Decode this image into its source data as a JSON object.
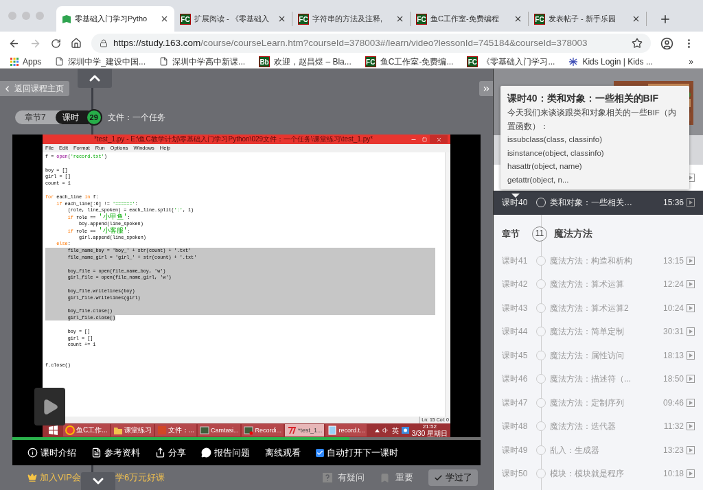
{
  "browser": {
    "tabs": [
      {
        "title": "零基础入门学习Pytho",
        "selected": true,
        "favicon": {
          "kind": "book"
        }
      },
      {
        "title": "扩展阅读 - 《零基础入",
        "selected": false,
        "favicon": {
          "kind": "letters",
          "text": "FC"
        }
      },
      {
        "title": "字符串的方法及注释,",
        "selected": false,
        "favicon": {
          "kind": "letters",
          "text": "FC"
        }
      },
      {
        "title": "鱼C工作室-免费编程",
        "selected": false,
        "favicon": {
          "kind": "letters",
          "text": "FC"
        }
      },
      {
        "title": "发表帖子 - 新手乐园",
        "selected": false,
        "favicon": {
          "kind": "letters",
          "text": "FC"
        }
      }
    ],
    "url": {
      "scheme": "https://",
      "host": "study.163.com",
      "path": "/course/courseLearn.htm?courseId=378003#/learn/video?lessonId=745184&courseId=378003"
    },
    "bookmarks": [
      {
        "label": "Apps",
        "icon": {
          "kind": "grid"
        }
      },
      {
        "label": "深圳中学_建设中国...",
        "icon": {
          "kind": "page"
        }
      },
      {
        "label": "深圳中学高中新课...",
        "icon": {
          "kind": "page"
        }
      },
      {
        "label": "欢迎，赵昌煜 – Bla...",
        "icon": {
          "kind": "letters",
          "text": "Bb"
        }
      },
      {
        "label": "鱼C工作室-免费编...",
        "icon": {
          "kind": "letters",
          "text": "FC"
        }
      },
      {
        "label": "《零基础入门学习...",
        "icon": {
          "kind": "letters",
          "text": "FC"
        }
      },
      {
        "label": "Kids Login | Kids ...",
        "icon": {
          "kind": "kids"
        }
      }
    ],
    "bookmarks_more": "»"
  },
  "player": {
    "back_button": "返回课程主页",
    "breadcrumb": {
      "chapter": "章节7",
      "lesson_label": "课时",
      "lesson_number": "29",
      "title": "文件：一个任务"
    },
    "recording": {
      "window_title": "*test_1.py - E:\\鱼C教学计划\\零基础入门学习Python\\029文件：一个任务\\课堂练习\\test_1.py*",
      "menu": [
        "File",
        "Edit",
        "Format",
        "Run",
        "Options",
        "Windows",
        "Help"
      ],
      "code_lines": [
        {
          "selected": false,
          "segments": [
            {
              "text": "f = ",
              "kind": "plain"
            },
            {
              "text": "open",
              "kind": "builtin"
            },
            {
              "text": "(",
              "kind": "plain"
            },
            {
              "text": "'record.txt'",
              "kind": "string"
            },
            {
              "text": ")",
              "kind": "plain"
            }
          ]
        },
        {
          "selected": false
        },
        {
          "selected": false,
          "segments": [
            {
              "text": "boy = []",
              "kind": "plain"
            }
          ]
        },
        {
          "selected": false,
          "segments": [
            {
              "text": "girl = []",
              "kind": "plain"
            }
          ]
        },
        {
          "selected": false,
          "segments": [
            {
              "text": "count = 1",
              "kind": "plain"
            }
          ]
        },
        {
          "selected": false
        },
        {
          "selected": false,
          "segments": [
            {
              "text": "for",
              "kind": "keyword"
            },
            {
              "text": " each_line ",
              "kind": "plain"
            },
            {
              "text": "in",
              "kind": "keyword"
            },
            {
              "text": " f:",
              "kind": "plain"
            }
          ]
        },
        {
          "selected": false,
          "segments": [
            {
              "text": "    if",
              "kind": "keyword"
            },
            {
              "text": " each_line[:6] != ",
              "kind": "plain"
            },
            {
              "text": "'======'",
              "kind": "string"
            },
            {
              "text": ":",
              "kind": "plain"
            }
          ]
        },
        {
          "selected": false,
          "segments": [
            {
              "text": "        (role, line_spoken) = each_line.split(",
              "kind": "plain"
            },
            {
              "text": "':'",
              "kind": "string"
            },
            {
              "text": ", 1)",
              "kind": "plain"
            }
          ]
        },
        {
          "selected": false,
          "segments": [
            {
              "text": "        if",
              "kind": "keyword"
            },
            {
              "text": " role == ",
              "kind": "plain"
            },
            {
              "text": "'小甲鱼'",
              "kind": "string"
            },
            {
              "text": ":",
              "kind": "plain"
            }
          ]
        },
        {
          "selected": false,
          "segments": [
            {
              "text": "            boy.append(line_spoken)",
              "kind": "plain"
            }
          ]
        },
        {
          "selected": false,
          "segments": [
            {
              "text": "        if",
              "kind": "keyword"
            },
            {
              "text": " role == ",
              "kind": "plain"
            },
            {
              "text": "'小客服'",
              "kind": "string"
            },
            {
              "text": ":",
              "kind": "plain"
            }
          ]
        },
        {
          "selected": false,
          "segments": [
            {
              "text": "            girl.append(line_spoken)",
              "kind": "plain"
            }
          ]
        },
        {
          "selected": false,
          "segments": [
            {
              "text": "    else",
              "kind": "keyword"
            },
            {
              "text": ":",
              "kind": "plain"
            }
          ]
        },
        {
          "selected": true,
          "segments": [
            {
              "text": "        file_name_boy = 'boy_' + str(count) + '.txt'",
              "kind": "plain"
            }
          ]
        },
        {
          "selected": true,
          "segments": [
            {
              "text": "        file_name_girl = 'girl_' + str(count) + '.txt'",
              "kind": "plain"
            }
          ]
        },
        {
          "selected": true
        },
        {
          "selected": true,
          "segments": [
            {
              "text": "        boy_file = open(file_name_boy, 'w')",
              "kind": "plain"
            }
          ]
        },
        {
          "selected": true,
          "segments": [
            {
              "text": "        girl_file = open(file_name_girl, 'w')",
              "kind": "plain"
            }
          ]
        },
        {
          "selected": true
        },
        {
          "selected": true,
          "segments": [
            {
              "text": "        boy_file.writelines(boy)",
              "kind": "plain"
            }
          ]
        },
        {
          "selected": true,
          "segments": [
            {
              "text": "        girl_file.writelines(girl)",
              "kind": "plain"
            }
          ]
        },
        {
          "selected": true
        },
        {
          "selected": true,
          "segments": [
            {
              "text": "        boy_file.close()",
              "kind": "plain"
            }
          ]
        },
        {
          "selected": true,
          "segments": [
            {
              "text": "        girl_file.close()",
              "kind": "plain"
            }
          ]
        },
        {
          "selected": false
        },
        {
          "selected": false,
          "segments": [
            {
              "text": "        boy = []",
              "kind": "plain"
            }
          ]
        },
        {
          "selected": false,
          "segments": [
            {
              "text": "        girl = []",
              "kind": "plain"
            }
          ]
        },
        {
          "selected": false,
          "segments": [
            {
              "text": "        count += 1",
              "kind": "plain"
            }
          ]
        },
        {
          "selected": false
        },
        {
          "selected": false
        },
        {
          "selected": false,
          "segments": [
            {
              "text": "f.close()",
              "kind": "plain"
            }
          ]
        }
      ],
      "status": "Ln: 15 Col: 0",
      "taskbar": [
        {
          "label": "鱼C工作...",
          "kind": "chrome",
          "selected": false
        },
        {
          "label": "课堂练习",
          "kind": "folder",
          "selected": false
        },
        {
          "label": "文件：...",
          "kind": "slides",
          "selected": false
        },
        {
          "label": "Camtasi...",
          "kind": "camtasia",
          "selected": false
        },
        {
          "label": "Recordi...",
          "kind": "recorder",
          "selected": false
        },
        {
          "label": "*test_1...",
          "kind": "idle",
          "selected": true
        },
        {
          "label": "record.t...",
          "kind": "notepad",
          "selected": false
        }
      ],
      "tray": {
        "language": "英",
        "time": "21:52",
        "date": "3/30 星期日"
      }
    },
    "progress": {
      "level": 0.72
    },
    "controls": [
      {
        "kind": "info",
        "label": "课时介绍"
      },
      {
        "kind": "document",
        "label": "参考资料"
      },
      {
        "kind": "share",
        "label": "分享"
      },
      {
        "kind": "chat",
        "label": "报告问题"
      },
      {
        "kind": "plain",
        "label": "离线观看"
      },
      {
        "kind": "checkbox",
        "label": "自动打开下一课时",
        "checked": true
      }
    ],
    "promo": {
      "before": "加入VIP会",
      "after": "学6万元好课"
    },
    "actions": [
      {
        "kind": "question",
        "label": "有疑问"
      },
      {
        "kind": "bookmark",
        "label": "重要"
      },
      {
        "kind": "done",
        "label": "学过了"
      }
    ]
  },
  "sidebar": {
    "tooltip": {
      "title": "课时40：类和对象：一些相关的BIF",
      "lines": [
        "今天我们来谈谈跟类和对象相关的一些BIF（内置函数）：",
        "issubclass(class, classinfo)",
        "isinstance(object, classinfo)",
        "hasattr(object, name)",
        "getattr(object, n..."
      ]
    },
    "items": [
      {
        "kind": "lesson",
        "number": "课时40",
        "title": "类和对象：一些相关…",
        "duration": "15:36",
        "selected": true
      },
      {
        "kind": "chapter",
        "label": "章节",
        "number": "11",
        "title": "魔法方法"
      },
      {
        "kind": "lesson",
        "number": "课时41",
        "title": "魔法方法：构造和析构",
        "duration": "13:15",
        "selected": false
      },
      {
        "kind": "lesson",
        "number": "课时42",
        "title": "魔法方法：算术运算",
        "duration": "12:24",
        "selected": false
      },
      {
        "kind": "lesson",
        "number": "课时43",
        "title": "魔法方法：算术运算2",
        "duration": "10:24",
        "selected": false
      },
      {
        "kind": "lesson",
        "number": "课时44",
        "title": "魔法方法：简单定制",
        "duration": "30:31",
        "selected": false
      },
      {
        "kind": "lesson",
        "number": "课时45",
        "title": "魔法方法：属性访问",
        "duration": "18:13",
        "selected": false
      },
      {
        "kind": "lesson",
        "number": "课时46",
        "title": "魔法方法：描述符（...",
        "duration": "18:50",
        "selected": false
      },
      {
        "kind": "lesson",
        "number": "课时47",
        "title": "魔法方法：定制序列",
        "duration": "09:46",
        "selected": false
      },
      {
        "kind": "lesson",
        "number": "课时48",
        "title": "魔法方法：迭代器",
        "duration": "11:32",
        "selected": false
      },
      {
        "kind": "lesson",
        "number": "课时49",
        "title": "乱入：生成器",
        "duration": "13:23",
        "selected": false
      },
      {
        "kind": "lesson",
        "number": "课时50",
        "title": "模块：模块就是程序",
        "duration": "10:18",
        "selected": false
      }
    ]
  }
}
